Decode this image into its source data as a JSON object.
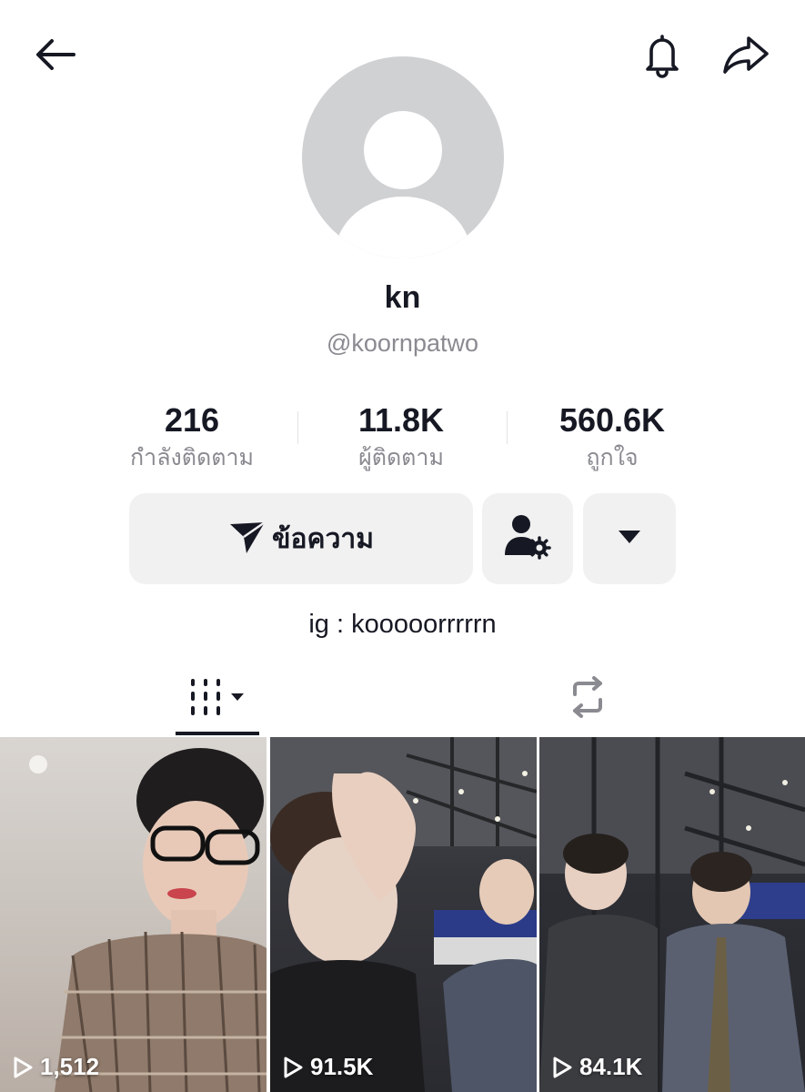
{
  "topbar": {
    "back_icon": "back-arrow-icon",
    "bell_icon": "bell-icon",
    "share_icon": "share-icon"
  },
  "profile": {
    "display_name": "kn",
    "username": "@koornpatwo",
    "bio": "ig : kooooorrrrrn"
  },
  "stats": [
    {
      "value": "216",
      "label": "กำลังติดตาม"
    },
    {
      "value": "11.8K",
      "label": "ผู้ติดตาม"
    },
    {
      "value": "560.6K",
      "label": "ถูกใจ"
    }
  ],
  "actions": {
    "message_label": "ข้อความ",
    "message_icon": "send-icon",
    "friend_icon": "user-settings-icon",
    "more_icon": "caret-down-icon"
  },
  "tabs": {
    "videos_icon": "videos-grid-icon",
    "reposts_icon": "repost-icon"
  },
  "videos": [
    {
      "views": "1,512"
    },
    {
      "views": "91.5K"
    },
    {
      "views": "84.1K"
    }
  ]
}
